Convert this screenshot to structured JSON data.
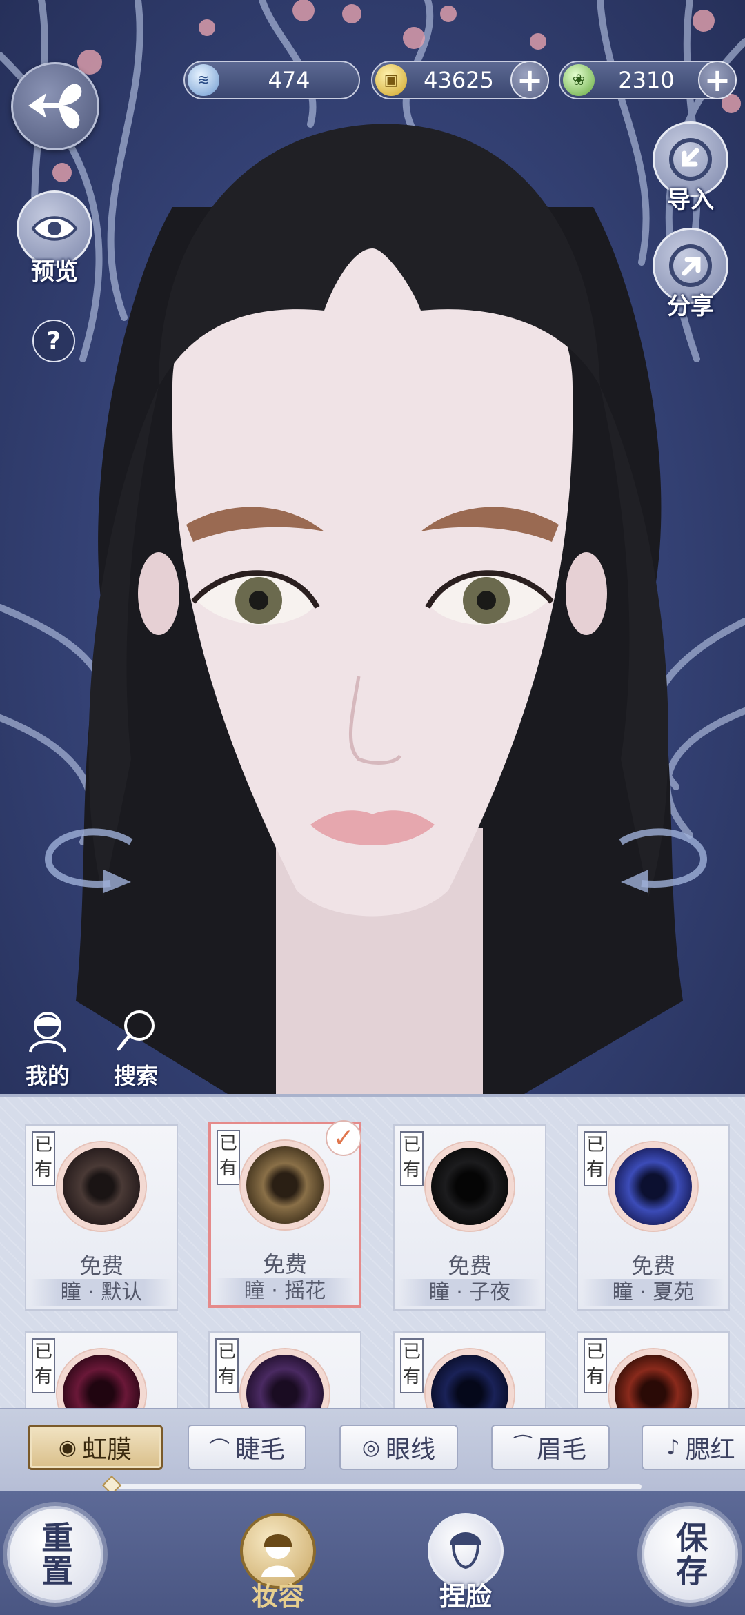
{
  "currencies": [
    {
      "icon": "jade-icon",
      "value": "474"
    },
    {
      "icon": "coin-icon",
      "value": "43625"
    },
    {
      "icon": "spirit-icon",
      "value": "2310"
    }
  ],
  "left_actions": {
    "preview": "预览",
    "help": "?"
  },
  "right_actions": {
    "import": "导入",
    "share": "分享"
  },
  "mini_actions": {
    "mine": "我的",
    "search": "搜索"
  },
  "iris_items": [
    {
      "owned": "已有",
      "price": "免费",
      "name": "瞳 · 默认",
      "selected": false,
      "color": "#4a3a36"
    },
    {
      "owned": "已有",
      "price": "免费",
      "name": "瞳 · 摇花",
      "selected": true,
      "color": "#6e5a3a"
    },
    {
      "owned": "已有",
      "price": "免费",
      "name": "瞳 · 子夜",
      "selected": false,
      "color": "#1c1c1e"
    },
    {
      "owned": "已有",
      "price": "免费",
      "name": "瞳 · 夏苑",
      "selected": false,
      "color": "#3c4cb8"
    },
    {
      "owned": "已有",
      "color": "#6a1838"
    },
    {
      "owned": "已有",
      "color": "#4a2a62"
    },
    {
      "owned": "已有",
      "color": "#1a2258"
    },
    {
      "owned": "已有",
      "color": "#8a2a1c"
    }
  ],
  "tabs": [
    {
      "label": "虹膜",
      "icon": "iris-icon",
      "active": true
    },
    {
      "label": "睫毛",
      "icon": "eyelash-icon",
      "active": false
    },
    {
      "label": "眼线",
      "icon": "eyeliner-icon",
      "active": false
    },
    {
      "label": "眉毛",
      "icon": "eyebrow-icon",
      "active": false
    },
    {
      "label": "腮红",
      "icon": "blush-icon",
      "active": false
    }
  ],
  "tab_scroll_progress": 0.0,
  "bottom": {
    "reset": "重置",
    "makeup": "妆容",
    "face": "捏脸",
    "save": "保存"
  },
  "colors": {
    "accent_gold": "#d9bf8a",
    "selected_border": "#e58a8a",
    "check": "#e0764d"
  }
}
